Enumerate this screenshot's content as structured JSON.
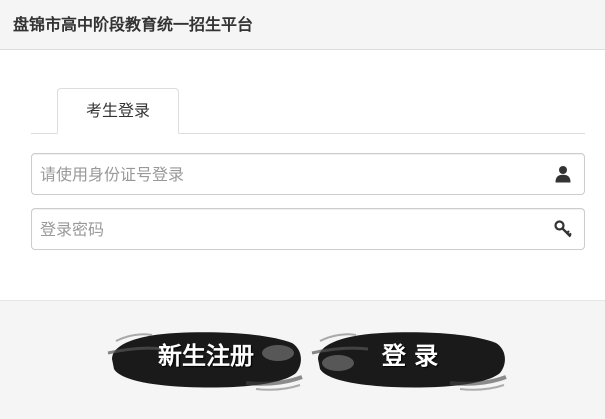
{
  "header": {
    "title": "盘锦市高中阶段教育统一招生平台"
  },
  "tabs": [
    {
      "label": "考生登录",
      "active": true
    }
  ],
  "form": {
    "id_field": {
      "placeholder": "请使用身份证号登录",
      "value": "",
      "icon": "user-icon"
    },
    "password_field": {
      "placeholder": "登录密码",
      "value": "",
      "icon": "key-icon"
    }
  },
  "actions": {
    "register_label": "新生注册",
    "login_label": "登 录"
  },
  "colors": {
    "header_bg": "#f5f5f5",
    "border": "#dddddd",
    "ink": "#1a1a1a",
    "placeholder": "#999999"
  }
}
